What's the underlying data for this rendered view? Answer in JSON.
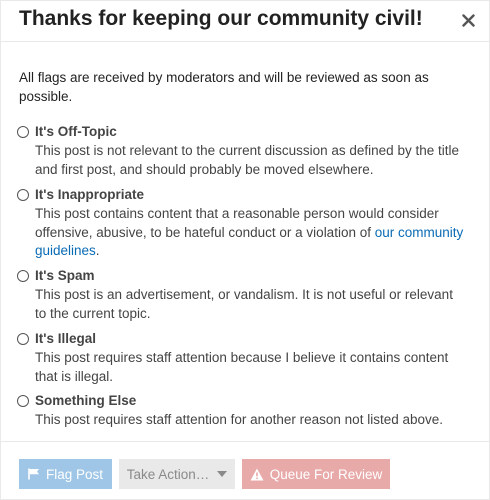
{
  "dialog": {
    "title": "Thanks for keeping our community civil!",
    "close_icon": "close-icon",
    "intro": "All flags are received by moderators and will be reviewed as soon as possible."
  },
  "options": [
    {
      "title": "It's Off-Topic",
      "description": "This post is not relevant to the current discussion as defined by the title and first post, and should probably be moved elsewhere."
    },
    {
      "title": "It's Inappropriate",
      "description_before": "This post contains content that a reasonable person would consider offensive, abusive, to be hateful conduct or a violation of ",
      "link_text": "our community guidelines",
      "description_after": "."
    },
    {
      "title": "It's Spam",
      "description": "This post is an advertisement, or vandalism. It is not useful or relevant to the current topic."
    },
    {
      "title": "It's Illegal",
      "description": "This post requires staff attention because I believe it contains content that is illegal."
    },
    {
      "title": "Something Else",
      "description": "This post requires staff attention for another reason not listed above."
    }
  ],
  "footer": {
    "flag_label": "Flag Post",
    "flag_icon": "flag-icon",
    "take_action_label": "Take Action…",
    "take_action_icon": "caret-down-icon",
    "queue_label": "Queue For Review",
    "queue_icon": "warning-icon"
  },
  "colors": {
    "link": "#0a6bb5",
    "flag_button": "#9fc6e6",
    "queue_button": "#e8a9a9",
    "take_action_button": "#e9e9e9"
  }
}
